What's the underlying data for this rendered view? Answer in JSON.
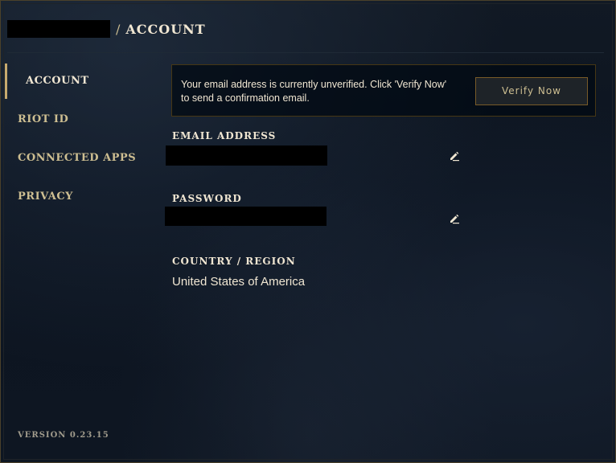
{
  "header": {
    "separator": "/",
    "title": "ACCOUNT"
  },
  "sidebar": {
    "items": [
      {
        "label": "ACCOUNT",
        "active": true
      },
      {
        "label": "RIOT ID",
        "active": false
      },
      {
        "label": "CONNECTED APPS",
        "active": false
      },
      {
        "label": "PRIVACY",
        "active": false
      }
    ],
    "version": "VERSION 0.23.15"
  },
  "notice": {
    "message": "Your email address is currently unverified. Click 'Verify Now' to send a confirmation email.",
    "button_label": "Verify Now"
  },
  "fields": {
    "email": {
      "label": "EMAIL ADDRESS",
      "edit_icon": "pencil-icon"
    },
    "password": {
      "label": "PASSWORD",
      "edit_icon": "pencil-icon"
    },
    "country": {
      "label": "COUNTRY / REGION",
      "value": "United States of America"
    }
  },
  "colors": {
    "accent_gold": "#c8aa6e",
    "text_light": "#f0e6d2",
    "text_gold": "#cdbe91",
    "background": "#0c1420"
  }
}
